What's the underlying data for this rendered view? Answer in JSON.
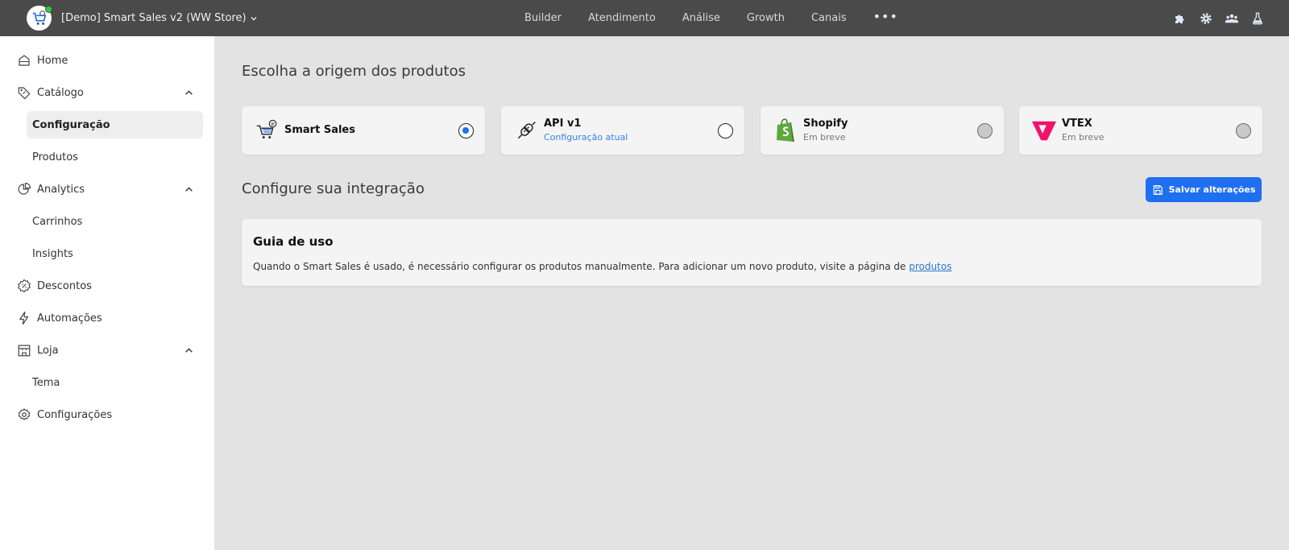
{
  "topbar": {
    "workspace": "[Demo] Smart Sales v2 (WW Store)",
    "nav": [
      "Builder",
      "Atendimento",
      "Análise",
      "Growth",
      "Canais"
    ],
    "more": "•••",
    "icons": [
      "puzzle-icon",
      "gear-icon",
      "team-icon",
      "flask-icon"
    ],
    "status_color": "#2ecc40"
  },
  "sidebar": {
    "home": "Home",
    "catalogo": "Catálogo",
    "configuracao": "Configuração",
    "produtos": "Produtos",
    "analytics": "Analytics",
    "carrinhos": "Carrinhos",
    "insights": "Insights",
    "descontos": "Descontos",
    "automacoes": "Automações",
    "loja": "Loja",
    "tema": "Tema",
    "configuracoes": "Configurações"
  },
  "main": {
    "origin_title": "Escolha a origem dos produtos",
    "sources": [
      {
        "title": "Smart Sales",
        "subtitle": "",
        "state": "selected"
      },
      {
        "title": "API v1",
        "subtitle": "Configuração atual",
        "state": "unselected"
      },
      {
        "title": "Shopify",
        "subtitle": "Em breve",
        "state": "disabled"
      },
      {
        "title": "VTEX",
        "subtitle": "Em breve",
        "state": "disabled"
      }
    ],
    "integration_title": "Configure sua integração",
    "save_label": "Salvar alterações",
    "guide": {
      "title": "Guia de uso",
      "text": "Quando o Smart Sales é usado, é necessário configurar os produtos manualmente. Para adicionar um novo produto, visite a página de ",
      "link": "produtos"
    }
  },
  "colors": {
    "accent": "#1f6ff0",
    "topbar": "#4a4a4a",
    "shopify": "#5fa83f",
    "vtex": "#f0136b"
  }
}
